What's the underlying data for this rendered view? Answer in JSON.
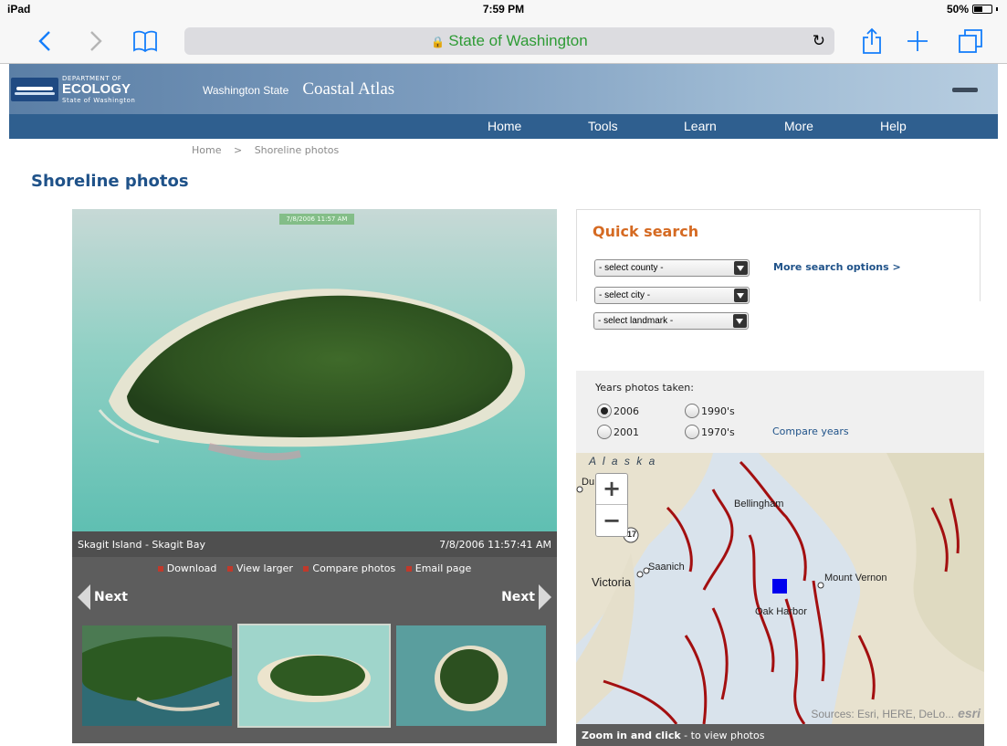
{
  "status_bar": {
    "device": "iPad",
    "time": "7:59 PM",
    "battery": "50%"
  },
  "browser": {
    "address": "State of Washington",
    "lock_icon": "lock-icon",
    "reload_icon": "reload-icon"
  },
  "site": {
    "logo_small": "DEPARTMENT OF",
    "logo_big": "ECOLOGY",
    "logo_sub": "State of Washington",
    "state_label": "Washington State",
    "atlas_label": "Coastal Atlas"
  },
  "nav": {
    "items": [
      "Home",
      "Tools",
      "Learn",
      "More",
      "Help"
    ]
  },
  "breadcrumb": {
    "home": "Home",
    "sep": ">",
    "current": "Shoreline photos"
  },
  "page": {
    "title": "Shoreline photos"
  },
  "photo": {
    "stamp": "7/8/2006 11:57 AM",
    "location": "Skagit Island - Skagit Bay",
    "timestamp": "7/8/2006 11:57:41 AM",
    "actions": [
      "Download",
      "View larger",
      "Compare photos",
      "Email page"
    ],
    "prev_label": "Next",
    "next_label": "Next"
  },
  "quick_search": {
    "title": "Quick search",
    "county": "- select county -",
    "city": "- select city -",
    "landmark": "- select landmark -",
    "more_options": "More search options >"
  },
  "years": {
    "label": "Years photos taken:",
    "options": [
      "2006",
      "1990's",
      "2001",
      "1970's"
    ],
    "selected": "2006",
    "compare": "Compare years"
  },
  "map": {
    "labels": {
      "alaska": "A l a s k a",
      "du": "Du",
      "bellingham": "Bellingham",
      "saanich": "Saanich",
      "victoria": "Victoria",
      "mount_vernon": "Mount Vernon",
      "oak_harbor": "Oak Harbor",
      "route": "17"
    },
    "zoom_in": "+",
    "zoom_out": "−",
    "attribution": "Sources: Esri, HERE, DeLo...",
    "esri": "esri",
    "footer_bold": "Zoom in and click",
    "footer_rest": " - to view photos"
  },
  "colors": {
    "accent": "#1f5289",
    "nav": "#2f5f8f",
    "orange": "#d56a22"
  }
}
